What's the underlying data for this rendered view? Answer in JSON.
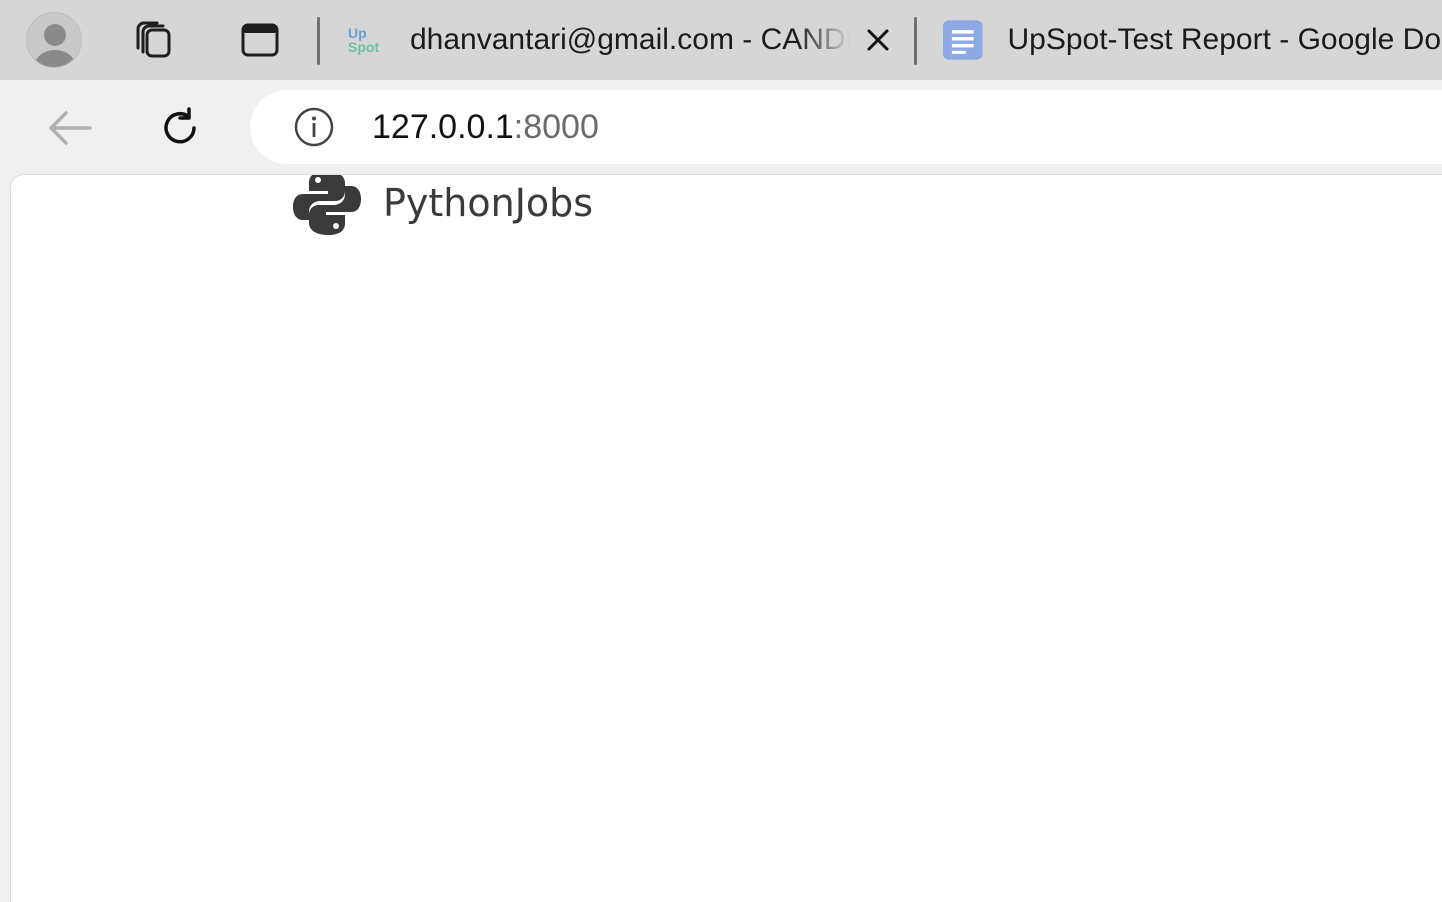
{
  "browser": {
    "tabs": [
      {
        "title": "dhanvantari@gmail.com - CANDIDATE",
        "favicon": {
          "line1": "Up",
          "line2": "Spot"
        },
        "icon": "upspot-favicon-icon",
        "active": false
      },
      {
        "title": "UpSpot-Test Report - Google Docs",
        "icon": "google-docs-icon",
        "active": false
      }
    ],
    "address_bar": {
      "host": "127.0.0.1",
      "port": ":8000"
    },
    "colors": {
      "tab_strip": "#d6d6d6",
      "toolbar": "#f0f0f0",
      "docs_blue": "#8fa9e6"
    }
  },
  "page": {
    "brand_name": "PythonJobs",
    "brand_icon": "python-logo-icon"
  }
}
